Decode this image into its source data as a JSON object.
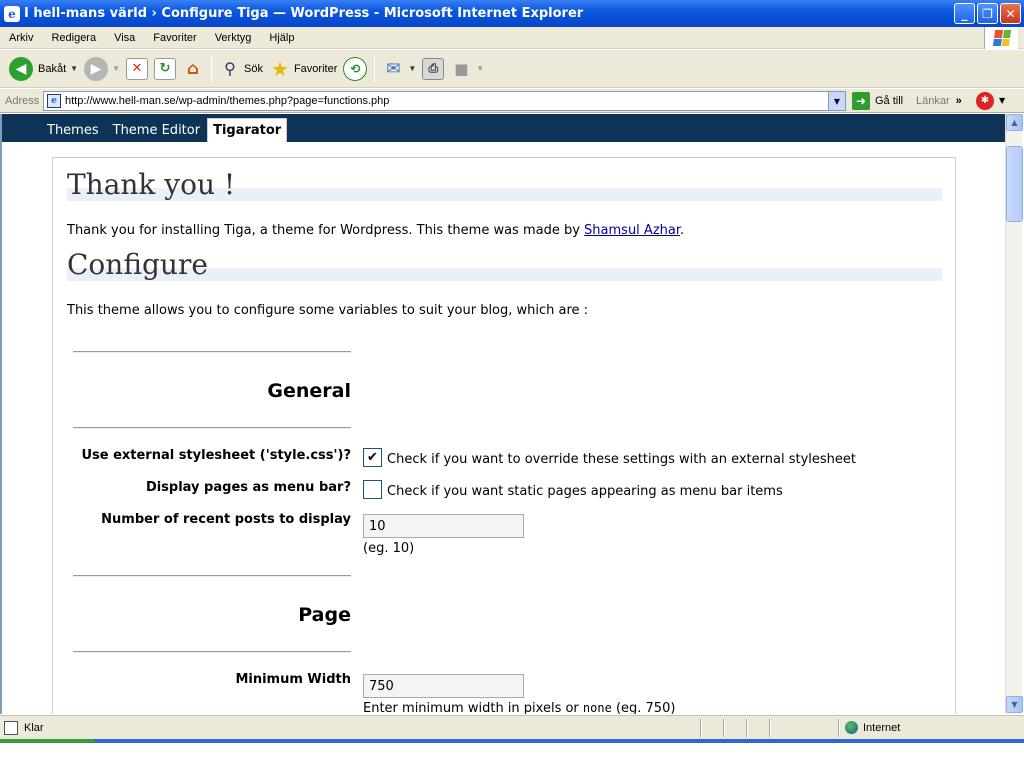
{
  "window": {
    "title": "I hell-mans värld › Configure Tiga — WordPress - Microsoft Internet Explorer",
    "minimize": "_",
    "maximize": "❐",
    "close": "✕"
  },
  "menu": [
    "Arkiv",
    "Redigera",
    "Visa",
    "Favoriter",
    "Verktyg",
    "Hjälp"
  ],
  "toolbar": {
    "back": "Bakåt",
    "search": "Sök",
    "favorites": "Favoriter"
  },
  "address": {
    "label": "Adress",
    "url": "http://www.hell-man.se/wp-admin/themes.php?page=functions.php",
    "go": "Gå till",
    "links": "Länkar"
  },
  "wp": {
    "tabs": [
      "Themes",
      "Theme Editor",
      "Tigarator"
    ],
    "active_tab": "Tigarator",
    "thanks_heading": "Thank you !",
    "thanks_text": "Thank you for installing Tiga, a theme for Wordpress. This theme was made by ",
    "author_link": "Shamsul Azhar",
    "thanks_end": ".",
    "configure_heading": "Configure",
    "configure_text": "This theme allows you to configure some variables to suit your blog, which are :",
    "general": {
      "title": "General",
      "external_label": "Use external stylesheet ('style.css')?",
      "external_checked": true,
      "external_text": "Check if you want to override these settings with an external stylesheet",
      "pages_label": "Display pages as menu bar?",
      "pages_checked": false,
      "pages_text": "Check if you want static pages appearing as menu bar items",
      "recent_label": "Number of recent posts to display",
      "recent_value": "10",
      "recent_hint": "(eg. 10)"
    },
    "page": {
      "title": "Page",
      "minwidth_label": "Minimum Width",
      "minwidth_value": "750",
      "minwidth_hint_a": "Enter minimum width in pixels or ",
      "minwidth_hint_code": "none",
      "minwidth_hint_b": " (eg. 750)"
    }
  },
  "status": {
    "text": "Klar",
    "zone": "Internet"
  }
}
